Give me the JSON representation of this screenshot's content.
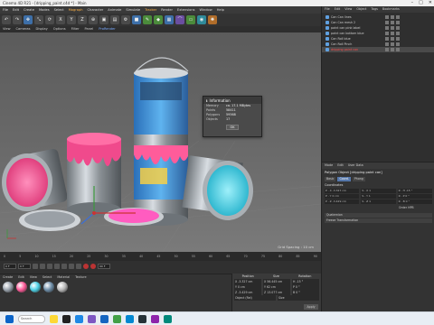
{
  "window": {
    "title": "Cinema 4D R21 - [dripping_paint.c4d *] - Main"
  },
  "menubar": [
    "File",
    "Edit",
    "Create",
    "Modes",
    "Select",
    "Mograph",
    "Character",
    "Animate",
    "Simulate",
    "Tracker",
    "Render",
    "Extensions",
    "Window",
    "Help"
  ],
  "viewport_menu": [
    "View",
    "Cameras",
    "Display",
    "Options",
    "Filter",
    "Panel",
    "ProRender"
  ],
  "viewport": {
    "grid_spacing": "Grid Spacing : 10 cm"
  },
  "info_dialog": {
    "title": "Information",
    "rows": [
      {
        "key": "Memory",
        "value": "ca. 17.1 MBytes"
      },
      {
        "key": "Points",
        "value": "58411"
      },
      {
        "key": "Polygons",
        "value": "59568"
      },
      {
        "key": "Objects",
        "value": "17"
      }
    ],
    "ok_label": "OK"
  },
  "timeline": {
    "ticks": [
      "0",
      "5",
      "10",
      "15",
      "20",
      "25",
      "30",
      "35",
      "40",
      "45",
      "50",
      "55",
      "60",
      "65",
      "70",
      "75",
      "80",
      "85",
      "90"
    ],
    "start": "0 F",
    "end": "90 F"
  },
  "material_menu": [
    "Create",
    "Edit",
    "View",
    "Select",
    "Material",
    "Texture"
  ],
  "materials": [
    {
      "color": "#9aa3ad"
    },
    {
      "color": "#ff5c9a"
    },
    {
      "color": "#4fd2e6"
    },
    {
      "color": "#6e8ea8"
    },
    {
      "color": "#b8b8b8"
    }
  ],
  "coords": {
    "headers": [
      "Position",
      "Size",
      "Rotation"
    ],
    "rows": [
      [
        "X  -3.327 cm",
        "X  56.445 cm",
        "H  -15 °"
      ],
      [
        "Y  0 cm",
        "Y  62 cm",
        "P  0 °"
      ],
      [
        "Z  -3.429 cm",
        "Z  13.077 cm",
        "B  0 °"
      ]
    ],
    "mode": "Object (Rel)",
    "size_mode": "Size",
    "apply_label": "Apply"
  },
  "object_manager": {
    "menu": [
      "File",
      "Edit",
      "View",
      "Object",
      "Tags",
      "Bookmarks"
    ],
    "items": [
      {
        "name": "Can Can lines",
        "selected": false,
        "red": false
      },
      {
        "name": "Can Can mesh 2",
        "selected": false,
        "red": false
      },
      {
        "name": "paint can pink label",
        "selected": false,
        "red": false
      },
      {
        "name": "paint can bottom blue",
        "selected": false,
        "red": false
      },
      {
        "name": "Can Roll blue",
        "selected": false,
        "red": false
      },
      {
        "name": "Can Roll Pinch",
        "selected": false,
        "red": false
      },
      {
        "name": "dripping paint can",
        "selected": true,
        "red": true
      }
    ]
  },
  "attributes": {
    "menu": [
      "Mode",
      "Edit",
      "User Data"
    ],
    "title": "Polygon Object [dripping paint can]",
    "tabs": [
      "Basic",
      "Coord.",
      "Phong"
    ],
    "section": "Coordinates",
    "lines": [
      [
        "P . X  -3.327 cm",
        "S . X  1",
        "R . H  -15 °"
      ],
      [
        "P . Y  0 cm",
        "S . Y  1",
        "R . P  0 °"
      ],
      [
        "P . Z  -3.429 cm",
        "S . Z  1",
        "R . B  0 °"
      ]
    ],
    "order_label": "Order  HPB",
    "bars": [
      "Quaternion",
      "Freeze Transformation"
    ]
  },
  "taskbar": {
    "search_placeholder": "Search"
  }
}
